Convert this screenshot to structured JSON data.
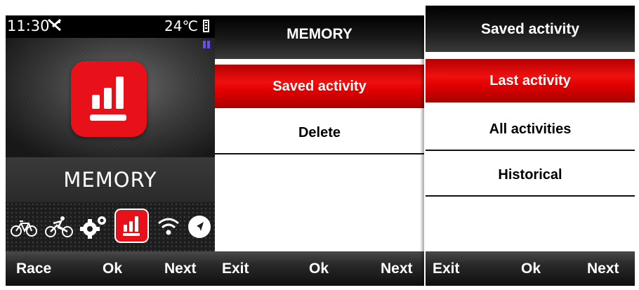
{
  "screen1": {
    "status": {
      "time": "11:30",
      "temperature": "24℃"
    },
    "icon_names": [
      "satellite-off-icon",
      "pause-icon",
      "memory-chart-icon",
      "battery-icon"
    ],
    "title": "MEMORY",
    "carousel": [
      "bike-icon",
      "bike-sport-icon",
      "gears-icon",
      "memory-icon",
      "wifi-icon",
      "navigation-icon"
    ],
    "selected_carousel": "memory-icon",
    "softkeys": {
      "left": "Race",
      "center": "Ok",
      "right": "Next"
    }
  },
  "screen2": {
    "header": "MEMORY",
    "items": [
      {
        "label": "Saved activity",
        "selected": true
      },
      {
        "label": "Delete",
        "selected": false
      }
    ],
    "softkeys": {
      "left": "Exit",
      "center": "Ok",
      "right": "Next"
    }
  },
  "screen3": {
    "header": "Saved activity",
    "items": [
      {
        "label": "Last activity",
        "selected": true
      },
      {
        "label": "All activities",
        "selected": false
      },
      {
        "label": "Historical",
        "selected": false
      }
    ],
    "softkeys": {
      "left": "Exit",
      "center": "Ok",
      "right": "Next"
    }
  },
  "colors": {
    "accent_red": "#e8111a",
    "pause_purple": "#6b4fe6"
  }
}
